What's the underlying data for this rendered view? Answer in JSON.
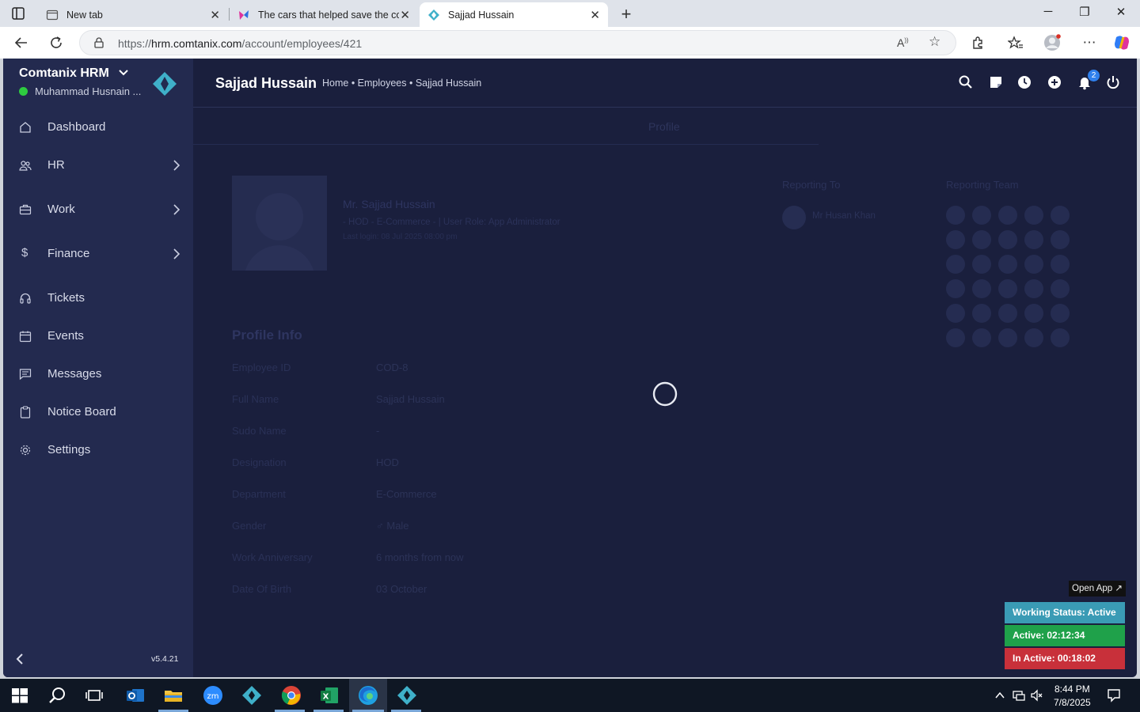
{
  "browser": {
    "tabs": [
      {
        "title": "New tab"
      },
      {
        "title": "The cars that helped save the cor"
      },
      {
        "title": "Sajjad Hussain"
      }
    ],
    "address": {
      "scheme": "https://",
      "host": "hrm.comtanix.com",
      "path": "/account/employees/421"
    }
  },
  "sidebar": {
    "brand": "Comtanix HRM",
    "user": "Muhammad Husnain ...",
    "items": [
      {
        "label": "Dashboard",
        "icon": "home-icon",
        "has_arrow": false
      },
      {
        "label": "HR",
        "icon": "users-icon",
        "has_arrow": true
      },
      {
        "label": "Work",
        "icon": "briefcase-icon",
        "has_arrow": true
      },
      {
        "label": "Finance",
        "icon": "dollar-icon",
        "has_arrow": true
      },
      {
        "label": "Tickets",
        "icon": "headset-icon",
        "has_arrow": false
      },
      {
        "label": "Events",
        "icon": "calendar-icon",
        "has_arrow": false
      },
      {
        "label": "Messages",
        "icon": "message-icon",
        "has_arrow": false
      },
      {
        "label": "Notice Board",
        "icon": "clipboard-icon",
        "has_arrow": false
      },
      {
        "label": "Settings",
        "icon": "gear-icon",
        "has_arrow": false
      }
    ],
    "version": "v5.4.21"
  },
  "header": {
    "title": "Sajjad Hussain",
    "breadcrumb": "Home • Employees • Sajjad Hussain",
    "notification_count": "2"
  },
  "profile": {
    "tab_label": "Profile",
    "name": "Mr. Sajjad Hussain",
    "role_line": "- HOD - E-Commerce - | User Role: App Administrator",
    "last_login": "Last login: 08 Jul 2025 08:00 pm",
    "reporting_to_label": "Reporting To",
    "reporting_to_name": "Mr Husan Khan",
    "reporting_team_label": "Reporting Team",
    "info_title": "Profile Info",
    "info": [
      {
        "key": "Employee ID",
        "value": "COD-8"
      },
      {
        "key": "Full Name",
        "value": "Sajjad Hussain"
      },
      {
        "key": "Sudo Name",
        "value": "-"
      },
      {
        "key": "Designation",
        "value": "HOD"
      },
      {
        "key": "Department",
        "value": "E-Commerce"
      },
      {
        "key": "Gender",
        "value": "♂ Male"
      },
      {
        "key": "Work Anniversary",
        "value": "6 months from now"
      },
      {
        "key": "Date Of Birth",
        "value": "03 October"
      }
    ]
  },
  "widget": {
    "open_app": "Open App ↗",
    "working_status": "Working Status: Active",
    "active": "Active: 02:12:34",
    "inactive": "In Active: 00:18:02",
    "colors": {
      "status": "#3a9bb5",
      "active": "#1fa14a",
      "inactive": "#c8303a"
    }
  },
  "taskbar": {
    "time": "8:44 PM",
    "date": "7/8/2025"
  }
}
